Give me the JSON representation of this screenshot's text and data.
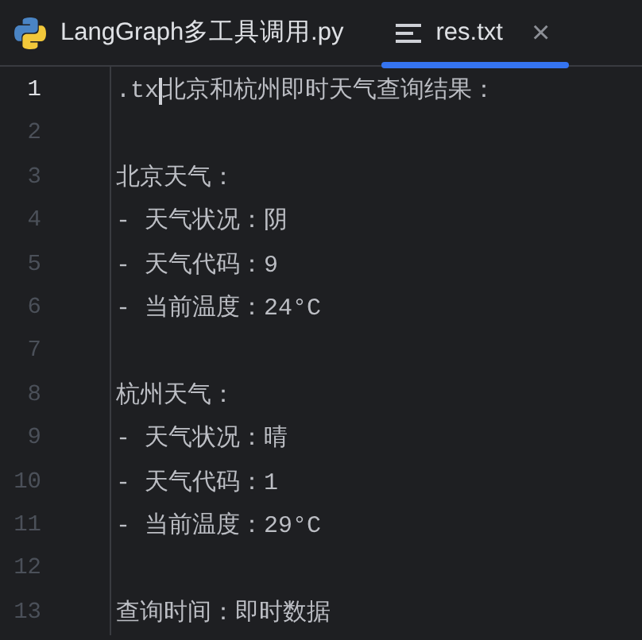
{
  "tabs": [
    {
      "kind": "python",
      "label": "LangGraph多工具调用.py",
      "selected": false,
      "closable": false
    },
    {
      "kind": "text",
      "label": "res.txt",
      "selected": true,
      "closable": true
    }
  ],
  "close_glyph": "×",
  "lines": [
    {
      "number": "1",
      "text": ".tx",
      "text_after_cursor": "北京和杭州即时天气查询结果：",
      "current": true
    },
    {
      "number": "2",
      "current": false
    },
    {
      "number": "3",
      "text": "北京天气：",
      "current": false
    },
    {
      "number": "4",
      "text": "- 天气状况：阴",
      "current": false
    },
    {
      "number": "5",
      "text": "- 天气代码：9",
      "current": false
    },
    {
      "number": "6",
      "text": "- 当前温度：24°C",
      "current": false
    },
    {
      "number": "7",
      "current": false
    },
    {
      "number": "8",
      "text": "杭州天气：",
      "current": false
    },
    {
      "number": "9",
      "text": "- 天气状况：晴",
      "current": false
    },
    {
      "number": "10",
      "text": "- 天气代码：1",
      "current": false
    },
    {
      "number": "11",
      "text": "- 当前温度：29°C",
      "current": false
    },
    {
      "number": "12",
      "current": false
    },
    {
      "number": "13",
      "text": "查询时间：即时数据",
      "current": false
    }
  ]
}
